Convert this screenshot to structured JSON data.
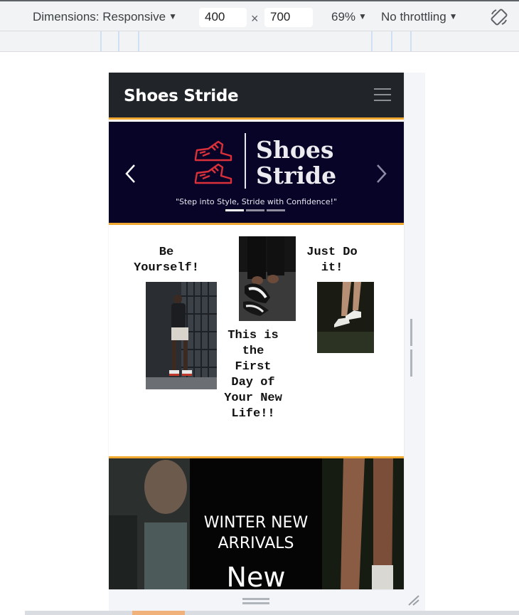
{
  "devtools": {
    "dimensions_label": "Dimensions: Responsive",
    "width_value": "400",
    "times": "×",
    "height_value": "700",
    "zoom": "69%",
    "throttling": "No throttling",
    "icons": [
      "caret-down-icon",
      "rotate-icon"
    ]
  },
  "site": {
    "brand": "Shoes Stride",
    "menu_icon": "hamburger-icon",
    "colors": {
      "navbar": "#212529",
      "accent": "#f0a830",
      "hero": "#080428",
      "logo_red": "#d9303a"
    },
    "carousel": {
      "logo_line1": "Shoes",
      "logo_line2": "Stride",
      "tagline": "\"Step into Style, Stride with Confidence!\"",
      "prev_icon": "chevron-left-icon",
      "next_icon": "chevron-right-icon"
    },
    "features": {
      "left": "Be Yourself!",
      "middle": "This is the First Day of Your New Life!!",
      "right": "Just Do it!"
    },
    "banner": {
      "line1": "WINTER NEW",
      "line2": "ARRIVALS",
      "big": "New"
    }
  }
}
